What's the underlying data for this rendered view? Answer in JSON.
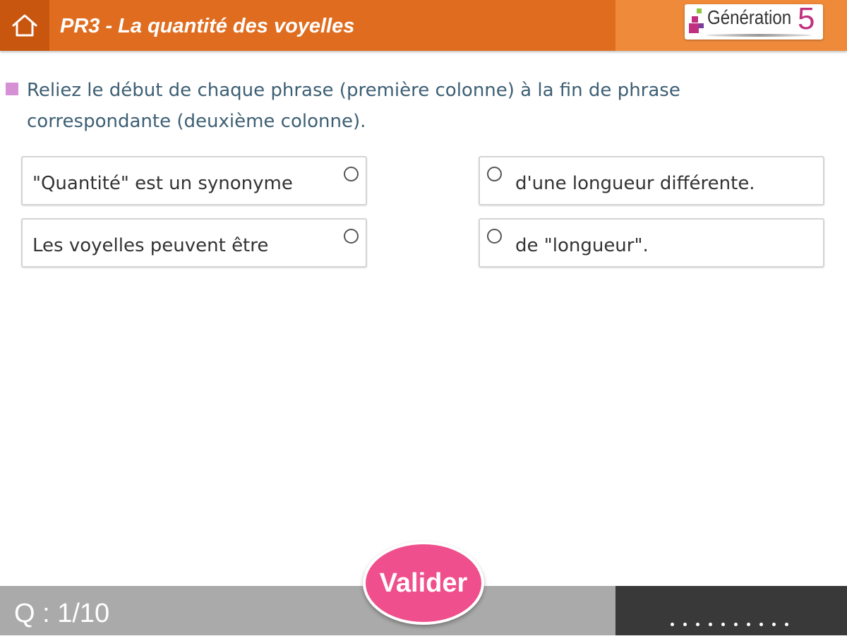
{
  "header": {
    "title": "PR3 - La quantité des voyelles",
    "home_icon": "home-icon",
    "logo_text": "Génération",
    "logo_number": "5"
  },
  "instruction": {
    "text": "Reliez le début de chaque phrase (première colonne) à la fin de phrase correspondante (deuxième colonne)."
  },
  "left_column": [
    {
      "label": "\"Quantité\" est un synonyme"
    },
    {
      "label": "Les voyelles peuvent être"
    }
  ],
  "right_column": [
    {
      "label": "d'une longueur différente."
    },
    {
      "label": "de \"longueur\"."
    }
  ],
  "footer": {
    "question_counter": "Q : 1/10",
    "validate_label": "Valider"
  },
  "colors": {
    "header": "#e06d1f",
    "header_home": "#c9560f",
    "header_right": "#ef8a3a",
    "instruction_text": "#3d5f74",
    "bullet": "#d690d6",
    "validate": "#ef4f8c",
    "footer": "#aaaaaa",
    "footer_right": "#393939"
  }
}
